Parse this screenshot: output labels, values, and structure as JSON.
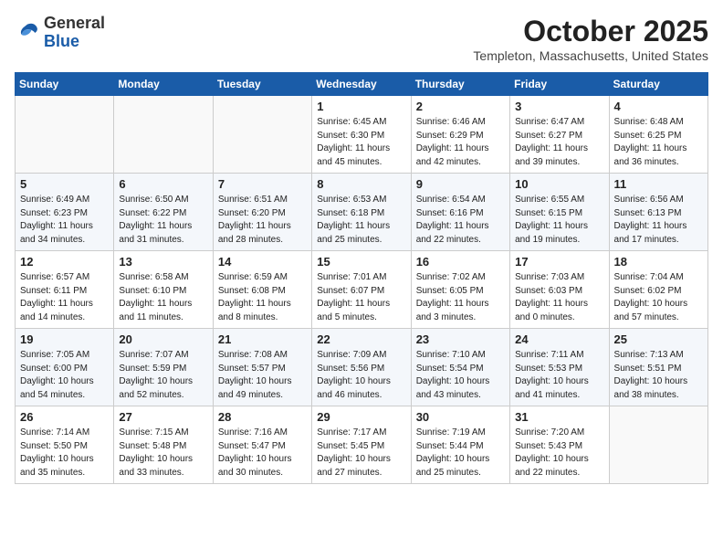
{
  "header": {
    "logo_general": "General",
    "logo_blue": "Blue",
    "month_year": "October 2025",
    "location": "Templeton, Massachusetts, United States"
  },
  "weekdays": [
    "Sunday",
    "Monday",
    "Tuesday",
    "Wednesday",
    "Thursday",
    "Friday",
    "Saturday"
  ],
  "weeks": [
    [
      {
        "day": "",
        "text": ""
      },
      {
        "day": "",
        "text": ""
      },
      {
        "day": "",
        "text": ""
      },
      {
        "day": "1",
        "text": "Sunrise: 6:45 AM\nSunset: 6:30 PM\nDaylight: 11 hours\nand 45 minutes."
      },
      {
        "day": "2",
        "text": "Sunrise: 6:46 AM\nSunset: 6:29 PM\nDaylight: 11 hours\nand 42 minutes."
      },
      {
        "day": "3",
        "text": "Sunrise: 6:47 AM\nSunset: 6:27 PM\nDaylight: 11 hours\nand 39 minutes."
      },
      {
        "day": "4",
        "text": "Sunrise: 6:48 AM\nSunset: 6:25 PM\nDaylight: 11 hours\nand 36 minutes."
      }
    ],
    [
      {
        "day": "5",
        "text": "Sunrise: 6:49 AM\nSunset: 6:23 PM\nDaylight: 11 hours\nand 34 minutes."
      },
      {
        "day": "6",
        "text": "Sunrise: 6:50 AM\nSunset: 6:22 PM\nDaylight: 11 hours\nand 31 minutes."
      },
      {
        "day": "7",
        "text": "Sunrise: 6:51 AM\nSunset: 6:20 PM\nDaylight: 11 hours\nand 28 minutes."
      },
      {
        "day": "8",
        "text": "Sunrise: 6:53 AM\nSunset: 6:18 PM\nDaylight: 11 hours\nand 25 minutes."
      },
      {
        "day": "9",
        "text": "Sunrise: 6:54 AM\nSunset: 6:16 PM\nDaylight: 11 hours\nand 22 minutes."
      },
      {
        "day": "10",
        "text": "Sunrise: 6:55 AM\nSunset: 6:15 PM\nDaylight: 11 hours\nand 19 minutes."
      },
      {
        "day": "11",
        "text": "Sunrise: 6:56 AM\nSunset: 6:13 PM\nDaylight: 11 hours\nand 17 minutes."
      }
    ],
    [
      {
        "day": "12",
        "text": "Sunrise: 6:57 AM\nSunset: 6:11 PM\nDaylight: 11 hours\nand 14 minutes."
      },
      {
        "day": "13",
        "text": "Sunrise: 6:58 AM\nSunset: 6:10 PM\nDaylight: 11 hours\nand 11 minutes."
      },
      {
        "day": "14",
        "text": "Sunrise: 6:59 AM\nSunset: 6:08 PM\nDaylight: 11 hours\nand 8 minutes."
      },
      {
        "day": "15",
        "text": "Sunrise: 7:01 AM\nSunset: 6:07 PM\nDaylight: 11 hours\nand 5 minutes."
      },
      {
        "day": "16",
        "text": "Sunrise: 7:02 AM\nSunset: 6:05 PM\nDaylight: 11 hours\nand 3 minutes."
      },
      {
        "day": "17",
        "text": "Sunrise: 7:03 AM\nSunset: 6:03 PM\nDaylight: 11 hours\nand 0 minutes."
      },
      {
        "day": "18",
        "text": "Sunrise: 7:04 AM\nSunset: 6:02 PM\nDaylight: 10 hours\nand 57 minutes."
      }
    ],
    [
      {
        "day": "19",
        "text": "Sunrise: 7:05 AM\nSunset: 6:00 PM\nDaylight: 10 hours\nand 54 minutes."
      },
      {
        "day": "20",
        "text": "Sunrise: 7:07 AM\nSunset: 5:59 PM\nDaylight: 10 hours\nand 52 minutes."
      },
      {
        "day": "21",
        "text": "Sunrise: 7:08 AM\nSunset: 5:57 PM\nDaylight: 10 hours\nand 49 minutes."
      },
      {
        "day": "22",
        "text": "Sunrise: 7:09 AM\nSunset: 5:56 PM\nDaylight: 10 hours\nand 46 minutes."
      },
      {
        "day": "23",
        "text": "Sunrise: 7:10 AM\nSunset: 5:54 PM\nDaylight: 10 hours\nand 43 minutes."
      },
      {
        "day": "24",
        "text": "Sunrise: 7:11 AM\nSunset: 5:53 PM\nDaylight: 10 hours\nand 41 minutes."
      },
      {
        "day": "25",
        "text": "Sunrise: 7:13 AM\nSunset: 5:51 PM\nDaylight: 10 hours\nand 38 minutes."
      }
    ],
    [
      {
        "day": "26",
        "text": "Sunrise: 7:14 AM\nSunset: 5:50 PM\nDaylight: 10 hours\nand 35 minutes."
      },
      {
        "day": "27",
        "text": "Sunrise: 7:15 AM\nSunset: 5:48 PM\nDaylight: 10 hours\nand 33 minutes."
      },
      {
        "day": "28",
        "text": "Sunrise: 7:16 AM\nSunset: 5:47 PM\nDaylight: 10 hours\nand 30 minutes."
      },
      {
        "day": "29",
        "text": "Sunrise: 7:17 AM\nSunset: 5:45 PM\nDaylight: 10 hours\nand 27 minutes."
      },
      {
        "day": "30",
        "text": "Sunrise: 7:19 AM\nSunset: 5:44 PM\nDaylight: 10 hours\nand 25 minutes."
      },
      {
        "day": "31",
        "text": "Sunrise: 7:20 AM\nSunset: 5:43 PM\nDaylight: 10 hours\nand 22 minutes."
      },
      {
        "day": "",
        "text": ""
      }
    ]
  ]
}
